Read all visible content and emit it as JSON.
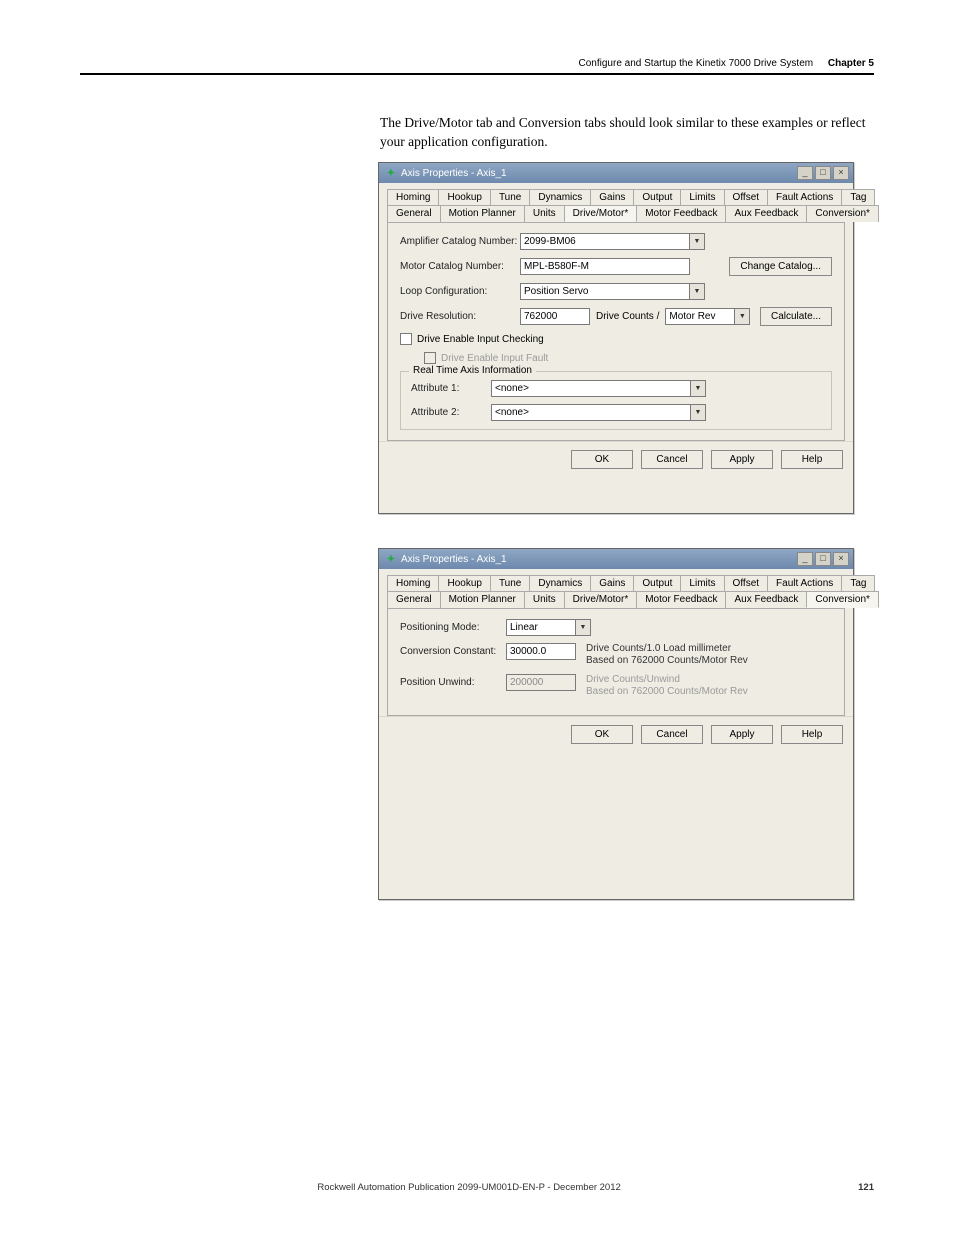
{
  "header": {
    "section_title": "Configure and Startup the Kinetix 7000 Drive System",
    "chapter_label": "Chapter 5"
  },
  "intro": "The Drive/Motor tab and Conversion tabs should look similar to these examples or reflect your application configuration.",
  "dialog1": {
    "title": "Axis Properties - Axis_1",
    "tabs_row1": [
      "Homing",
      "Hookup",
      "Tune",
      "Dynamics",
      "Gains",
      "Output",
      "Limits",
      "Offset",
      "Fault Actions",
      "Tag"
    ],
    "tabs_row2": [
      "General",
      "Motion Planner",
      "Units",
      "Drive/Motor*",
      "Motor Feedback",
      "Aux Feedback",
      "Conversion*"
    ],
    "active_tab": "Drive/Motor*",
    "fields": {
      "amp_label": "Amplifier Catalog Number:",
      "amp_value": "2099-BM06",
      "motor_label": "Motor Catalog Number:",
      "motor_value": "MPL-B580F-M",
      "change_catalog": "Change Catalog...",
      "loop_label": "Loop Configuration:",
      "loop_value": "Position Servo",
      "res_label": "Drive Resolution:",
      "res_value": "762000",
      "res_mid": "Drive Counts /",
      "res_unit": "Motor Rev",
      "calculate": "Calculate...",
      "enable_check": "Drive Enable Input Checking",
      "enable_fault": "Drive Enable Input Fault",
      "rt_legend": "Real Time Axis Information",
      "attr1_label": "Attribute 1:",
      "attr1_value": "<none>",
      "attr2_label": "Attribute 2:",
      "attr2_value": "<none>"
    },
    "buttons": {
      "ok": "OK",
      "cancel": "Cancel",
      "apply": "Apply",
      "help": "Help"
    }
  },
  "dialog2": {
    "title": "Axis Properties - Axis_1",
    "tabs_row1": [
      "Homing",
      "Hookup",
      "Tune",
      "Dynamics",
      "Gains",
      "Output",
      "Limits",
      "Offset",
      "Fault Actions",
      "Tag"
    ],
    "tabs_row2": [
      "General",
      "Motion Planner",
      "Units",
      "Drive/Motor*",
      "Motor Feedback",
      "Aux Feedback",
      "Conversion*"
    ],
    "active_tab": "Conversion*",
    "fields": {
      "pos_label": "Positioning Mode:",
      "pos_value": "Linear",
      "conv_label": "Conversion Constant:",
      "conv_value": "30000.0",
      "conv_hint1": "Drive Counts/1.0 Load millimeter",
      "conv_hint2": "Based on 762000 Counts/Motor Rev",
      "unwind_label": "Position Unwind:",
      "unwind_value": "200000",
      "unwind_hint1": "Drive Counts/Unwind",
      "unwind_hint2": "Based on 762000 Counts/Motor Rev"
    },
    "buttons": {
      "ok": "OK",
      "cancel": "Cancel",
      "apply": "Apply",
      "help": "Help"
    }
  },
  "footer": {
    "pub": "Rockwell Automation Publication 2099-UM001D-EN-P - December 2012",
    "page": "121"
  }
}
